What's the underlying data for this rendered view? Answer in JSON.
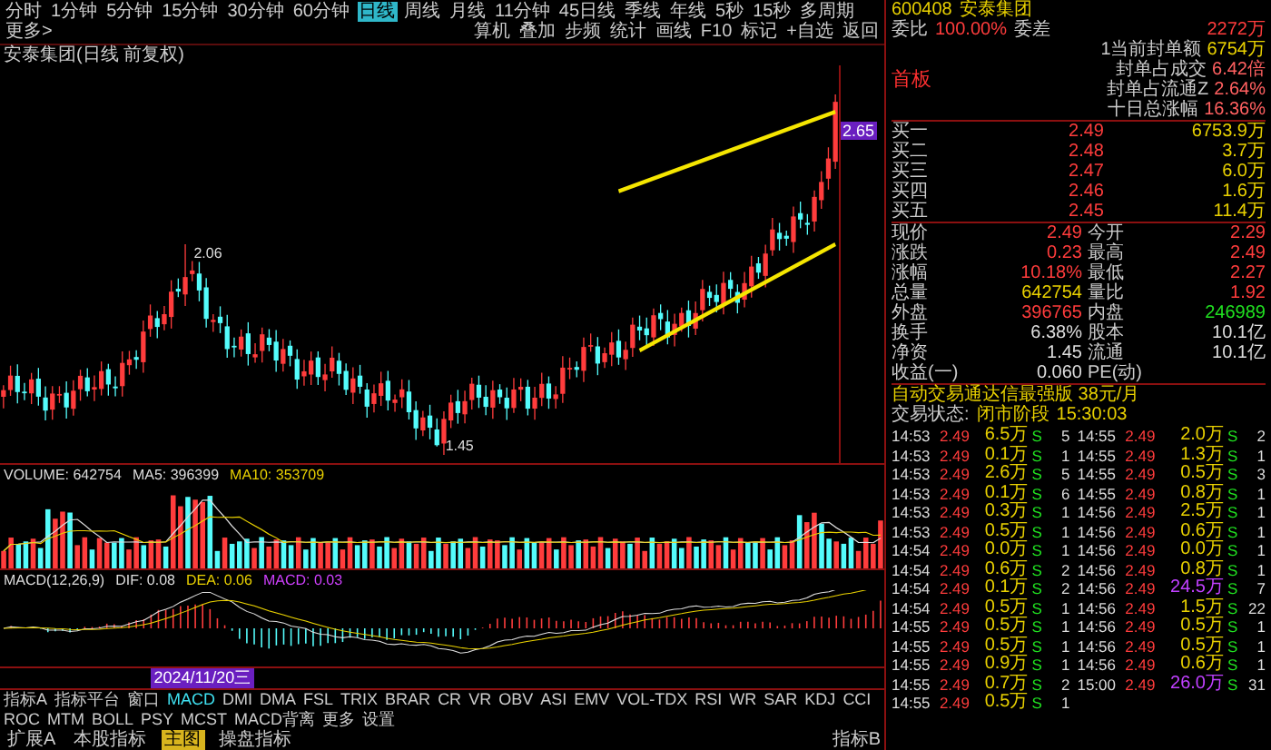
{
  "toolbar": {
    "periods": [
      {
        "label": "分时",
        "selected": false
      },
      {
        "label": "1分钟",
        "selected": false
      },
      {
        "label": "5分钟",
        "selected": false
      },
      {
        "label": "15分钟",
        "selected": false
      },
      {
        "label": "30分钟",
        "selected": false
      },
      {
        "label": "60分钟",
        "selected": false
      },
      {
        "label": "日线",
        "selected": true
      },
      {
        "label": "周线",
        "selected": false
      },
      {
        "label": "月线",
        "selected": false
      },
      {
        "label": "11分钟",
        "selected": false
      },
      {
        "label": "45日线",
        "selected": false
      },
      {
        "label": "季线",
        "selected": false
      },
      {
        "label": "年线",
        "selected": false
      },
      {
        "label": "5秒",
        "selected": false
      },
      {
        "label": "15秒",
        "selected": false
      },
      {
        "label": "多周期",
        "selected": false
      },
      {
        "label": "更多>",
        "selected": false
      }
    ],
    "tools": [
      "算机",
      "叠加",
      "步频",
      "统计",
      "画线",
      "F10",
      "标记",
      "+自选",
      "返回"
    ]
  },
  "chart": {
    "title": "安泰集团(日线 前复权)",
    "high_label": "2.06",
    "low_label": "1.45",
    "price_tag": "2.65"
  },
  "volume": {
    "name": "VOLUME: 642754",
    "ma5": "MA5: 396399",
    "ma10": "MA10: 353709"
  },
  "macd": {
    "name": "MACD(12,26,9)",
    "dif": "DIF: 0.08",
    "dea": "DEA: 0.06",
    "macd": "MACD: 0.03"
  },
  "date_tag": "2024/11/20三",
  "indicator_tabs": [
    {
      "label": "指标A",
      "selected": false
    },
    {
      "label": "指标平台",
      "selected": false
    },
    {
      "label": "窗口",
      "selected": false
    },
    {
      "label": "MACD",
      "selected": true
    },
    {
      "label": "DMI",
      "selected": false
    },
    {
      "label": "DMA",
      "selected": false
    },
    {
      "label": "FSL",
      "selected": false
    },
    {
      "label": "TRIX",
      "selected": false
    },
    {
      "label": "BRAR",
      "selected": false
    },
    {
      "label": "CR",
      "selected": false
    },
    {
      "label": "VR",
      "selected": false
    },
    {
      "label": "OBV",
      "selected": false
    },
    {
      "label": "ASI",
      "selected": false
    },
    {
      "label": "EMV",
      "selected": false
    },
    {
      "label": "VOL-TDX",
      "selected": false
    },
    {
      "label": "RSI",
      "selected": false
    },
    {
      "label": "WR",
      "selected": false
    },
    {
      "label": "SAR",
      "selected": false
    },
    {
      "label": "KDJ",
      "selected": false
    },
    {
      "label": "CCI",
      "selected": false
    },
    {
      "label": "ROC",
      "selected": false
    },
    {
      "label": "MTM",
      "selected": false
    },
    {
      "label": "BOLL",
      "selected": false
    },
    {
      "label": "PSY",
      "selected": false
    },
    {
      "label": "MCST",
      "selected": false
    },
    {
      "label": "MACD背离",
      "selected": false
    },
    {
      "label": "更多",
      "selected": false
    },
    {
      "label": "设置",
      "selected": false
    }
  ],
  "extra_tabs": [
    {
      "label": "扩展A",
      "selected": false
    },
    {
      "label": "本股指标",
      "selected": false
    },
    {
      "label": "主图",
      "selected": true
    },
    {
      "label": "操盘指标",
      "selected": false
    }
  ],
  "indicator_b": "指标B",
  "quote": {
    "code": "600408",
    "name": "安泰集团",
    "wei_bi_label": "委比",
    "wei_bi": "100.00%",
    "wei_cha_label": "委差",
    "wei_cha": "2272万",
    "badge": "首板",
    "limit_stats": [
      {
        "label": "1当前封单额",
        "value": "6754万"
      },
      {
        "label": "封单占成交",
        "value": "6.42倍"
      },
      {
        "label": "封单占流通Z",
        "value": "2.64%"
      },
      {
        "label": "十日总涨幅",
        "value": "16.36%"
      }
    ],
    "order_book": [
      {
        "label": "买一",
        "price": "2.49",
        "volume": "6753.9万"
      },
      {
        "label": "买二",
        "price": "2.48",
        "volume": "3.7万"
      },
      {
        "label": "买三",
        "price": "2.47",
        "volume": "6.0万"
      },
      {
        "label": "买四",
        "price": "2.46",
        "volume": "1.6万"
      },
      {
        "label": "买五",
        "price": "2.45",
        "volume": "11.4万"
      }
    ],
    "stats": [
      {
        "label": "现价",
        "value": "2.49",
        "color": "#ff3c3c"
      },
      {
        "label": "今开",
        "value": "2.29",
        "color": "#ff3c3c"
      },
      {
        "label": "涨跌",
        "value": "0.23",
        "color": "#ff3c3c"
      },
      {
        "label": "最高",
        "value": "2.49",
        "color": "#ff3c3c"
      },
      {
        "label": "涨幅",
        "value": "10.18%",
        "color": "#ff3c3c"
      },
      {
        "label": "最低",
        "value": "2.27",
        "color": "#ff3c3c"
      },
      {
        "label": "总量",
        "value": "642754",
        "color": "#e8d000"
      },
      {
        "label": "量比",
        "value": "1.92",
        "color": "#ff3c3c"
      },
      {
        "label": "外盘",
        "value": "396765",
        "color": "#ff3c3c"
      },
      {
        "label": "内盘",
        "value": "246989",
        "color": "#20e020"
      },
      {
        "label": "换手",
        "value": "6.38%",
        "color": "#dddddd"
      },
      {
        "label": "股本",
        "value": "10.1亿",
        "color": "#dddddd"
      },
      {
        "label": "净资",
        "value": "1.45",
        "color": "#dddddd"
      },
      {
        "label": "流通",
        "value": "10.1亿",
        "color": "#dddddd"
      },
      {
        "label": "收益(一)",
        "value": "0.060",
        "color": "#dddddd"
      },
      {
        "label": "PE(动)"
      }
    ],
    "promo": "自动交易通达信最强版 38元/月",
    "status_label": "交易状态:",
    "status": "闭市阶段",
    "status_time": "15:30:03"
  },
  "ticks": [
    {
      "time": "14:53",
      "price": "2.49",
      "volume": "6.5万",
      "side": "S",
      "count": "5",
      "large": false
    },
    {
      "time": "14:53",
      "price": "2.49",
      "volume": "0.1万",
      "side": "S",
      "count": "1",
      "large": false
    },
    {
      "time": "14:53",
      "price": "2.49",
      "volume": "2.6万",
      "side": "S",
      "count": "5",
      "large": false
    },
    {
      "time": "14:53",
      "price": "2.49",
      "volume": "0.1万",
      "side": "S",
      "count": "6",
      "large": false
    },
    {
      "time": "14:53",
      "price": "2.49",
      "volume": "0.3万",
      "side": "S",
      "count": "1",
      "large": false
    },
    {
      "time": "14:53",
      "price": "2.49",
      "volume": "0.5万",
      "side": "S",
      "count": "1",
      "large": false
    },
    {
      "time": "14:54",
      "price": "2.49",
      "volume": "0.0万",
      "side": "S",
      "count": "1",
      "large": false
    },
    {
      "time": "14:54",
      "price": "2.49",
      "volume": "0.6万",
      "side": "S",
      "count": "2",
      "large": false
    },
    {
      "time": "14:54",
      "price": "2.49",
      "volume": "0.1万",
      "side": "S",
      "count": "2",
      "large": false
    },
    {
      "time": "14:54",
      "price": "2.49",
      "volume": "0.5万",
      "side": "S",
      "count": "1",
      "large": false
    },
    {
      "time": "14:55",
      "price": "2.49",
      "volume": "0.5万",
      "side": "S",
      "count": "1",
      "large": false
    },
    {
      "time": "14:55",
      "price": "2.49",
      "volume": "0.5万",
      "side": "S",
      "count": "1",
      "large": false
    },
    {
      "time": "14:55",
      "price": "2.49",
      "volume": "0.9万",
      "side": "S",
      "count": "1",
      "large": false
    },
    {
      "time": "14:55",
      "price": "2.49",
      "volume": "0.7万",
      "side": "S",
      "count": "2",
      "large": false
    },
    {
      "time": "14:55",
      "price": "2.49",
      "volume": "0.5万",
      "side": "S",
      "count": "1",
      "large": false
    },
    {
      "time": "14:55",
      "price": "2.49",
      "volume": "2.0万",
      "side": "S",
      "count": "2",
      "large": false
    },
    {
      "time": "14:55",
      "price": "2.49",
      "volume": "1.3万",
      "side": "S",
      "count": "1",
      "large": false
    },
    {
      "time": "14:55",
      "price": "2.49",
      "volume": "0.5万",
      "side": "S",
      "count": "3",
      "large": false
    },
    {
      "time": "14:55",
      "price": "2.49",
      "volume": "0.8万",
      "side": "S",
      "count": "1",
      "large": false
    },
    {
      "time": "14:56",
      "price": "2.49",
      "volume": "2.5万",
      "side": "S",
      "count": "1",
      "large": false
    },
    {
      "time": "14:56",
      "price": "2.49",
      "volume": "0.6万",
      "side": "S",
      "count": "1",
      "large": false
    },
    {
      "time": "14:56",
      "price": "2.49",
      "volume": "0.0万",
      "side": "S",
      "count": "1",
      "large": false
    },
    {
      "time": "14:56",
      "price": "2.49",
      "volume": "0.8万",
      "side": "S",
      "count": "1",
      "large": false
    },
    {
      "time": "14:56",
      "price": "2.49",
      "volume": "24.5万",
      "side": "S",
      "count": "7",
      "large": true
    },
    {
      "time": "14:56",
      "price": "2.49",
      "volume": "1.5万",
      "side": "S",
      "count": "22",
      "large": false
    },
    {
      "time": "14:56",
      "price": "2.49",
      "volume": "0.5万",
      "side": "S",
      "count": "1",
      "large": false
    },
    {
      "time": "14:56",
      "price": "2.49",
      "volume": "0.5万",
      "side": "S",
      "count": "1",
      "large": false
    },
    {
      "time": "14:56",
      "price": "2.49",
      "volume": "0.6万",
      "side": "S",
      "count": "1",
      "large": false
    },
    {
      "time": "15:00",
      "price": "2.49",
      "volume": "26.0万",
      "side": "S",
      "count": "31",
      "large": true
    }
  ]
}
